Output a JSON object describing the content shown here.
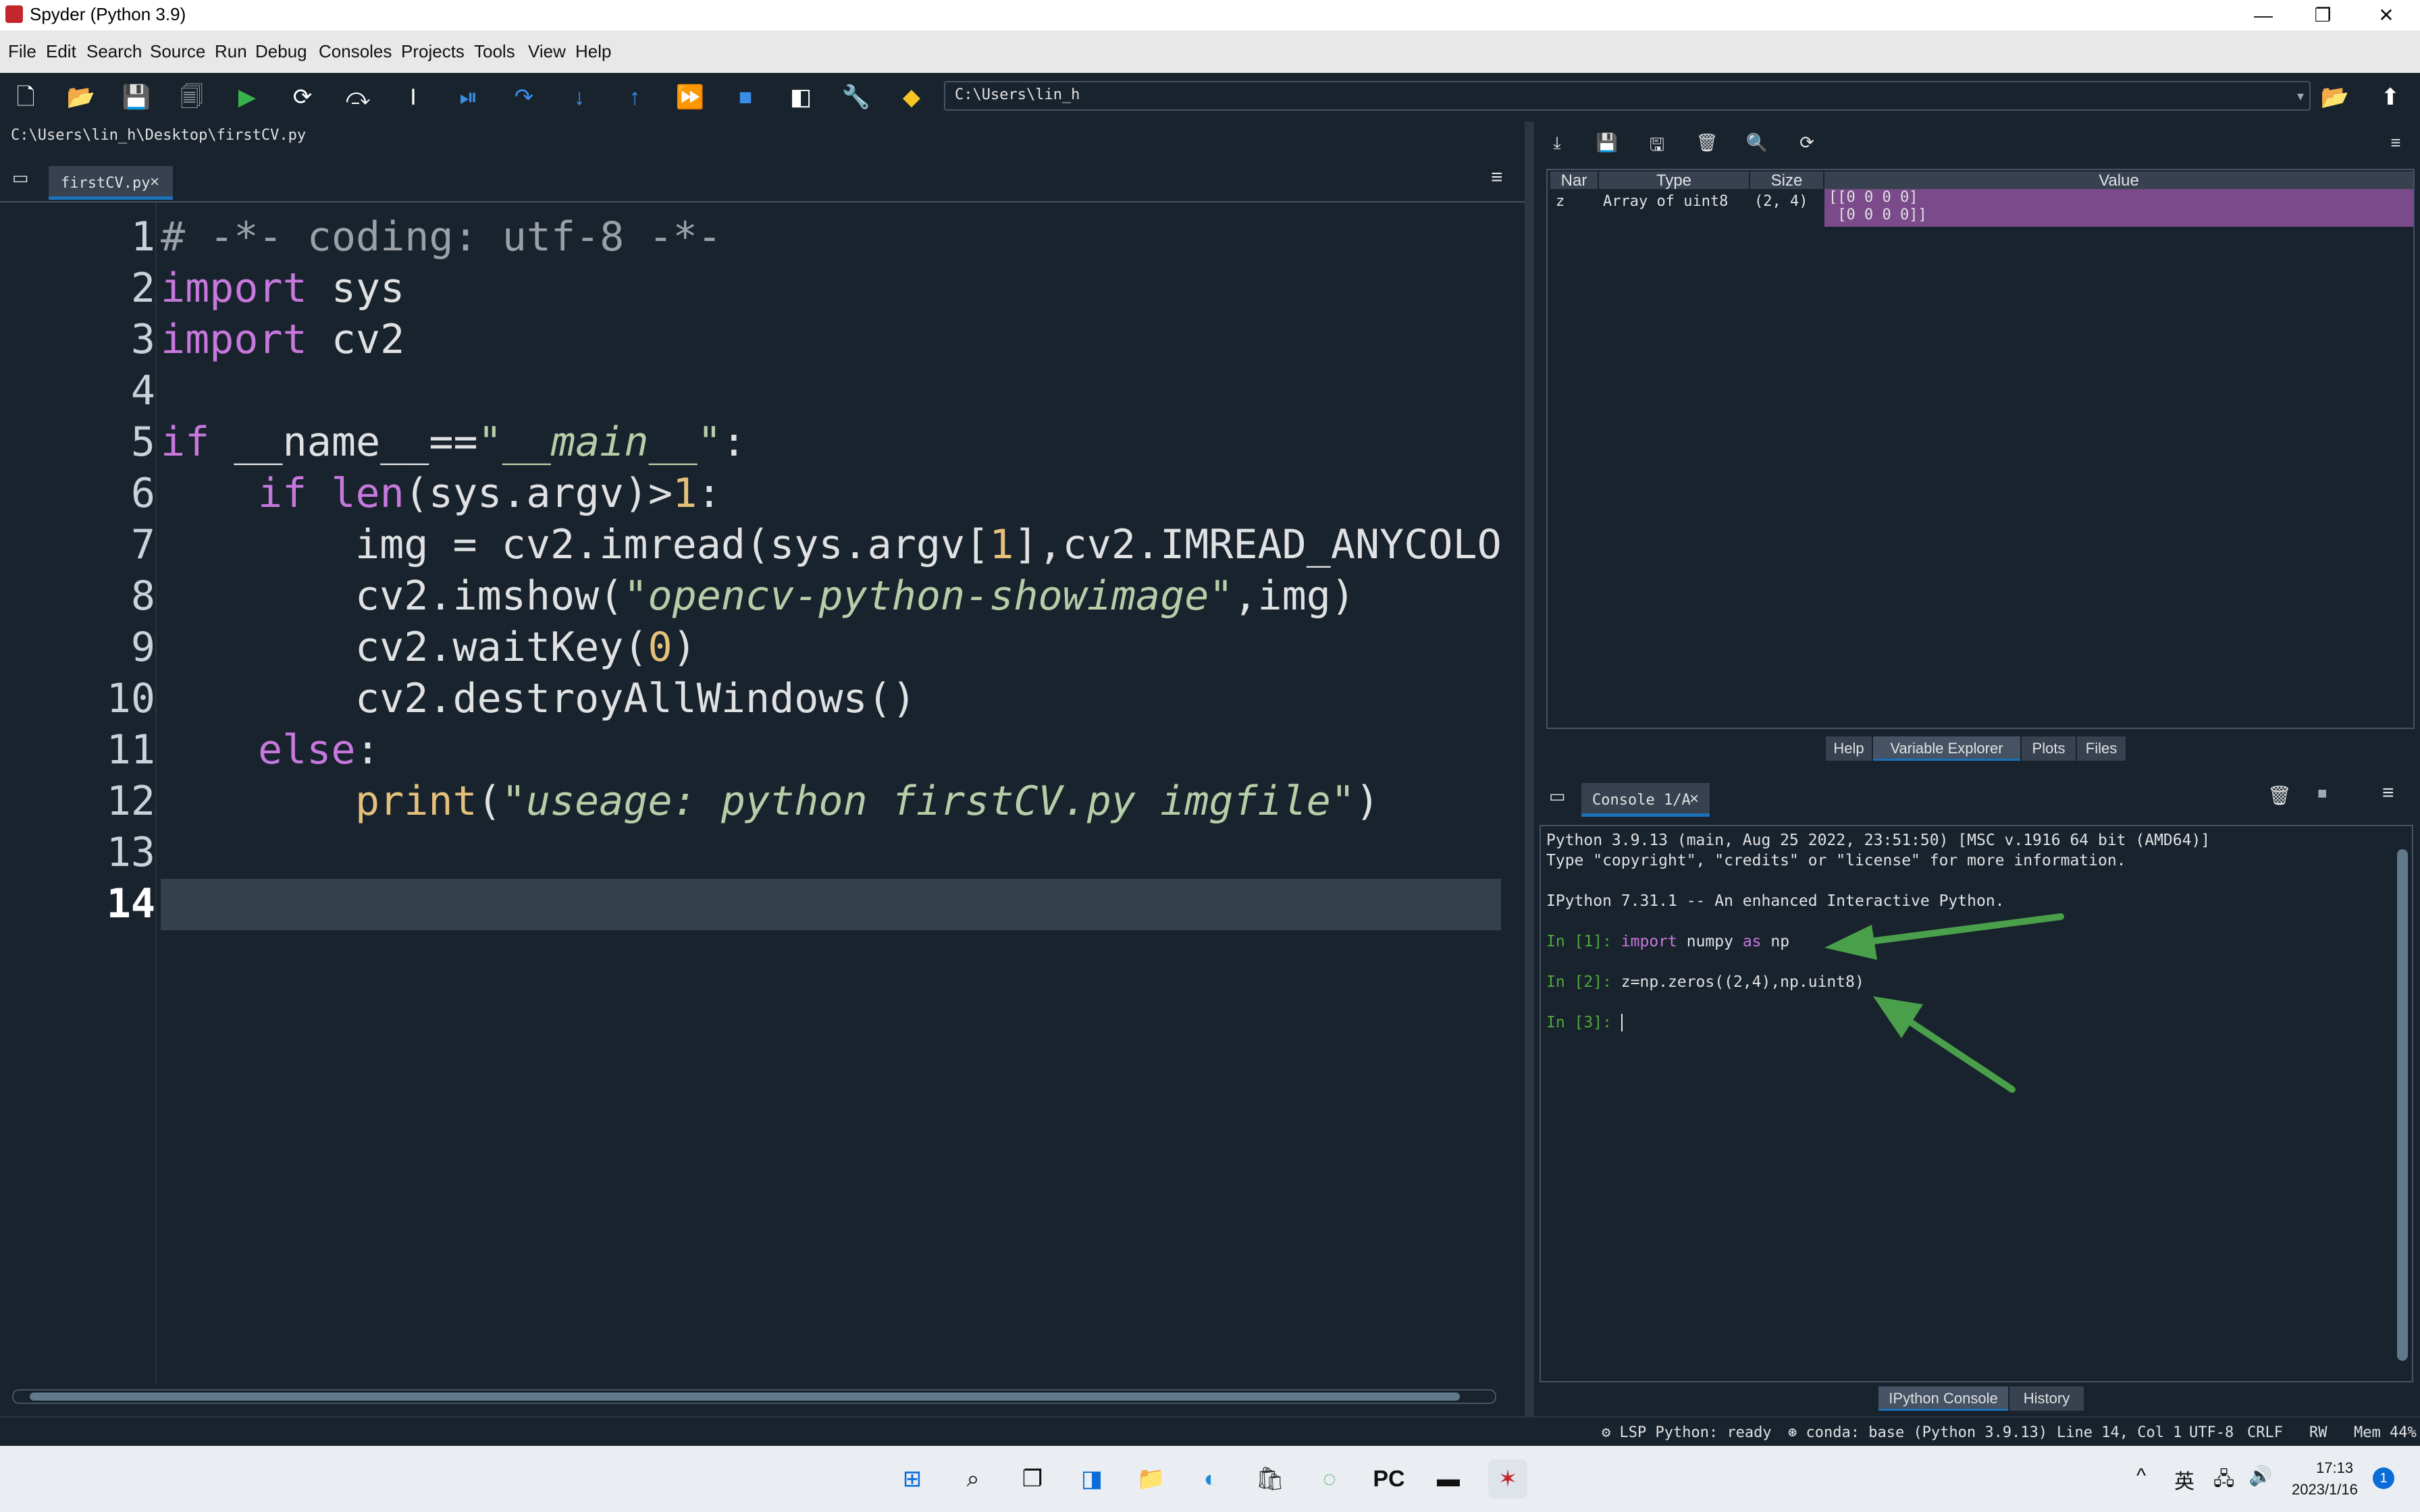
{
  "window": {
    "title": "Spyder (Python 3.9)",
    "controls": {
      "minimize": "—",
      "restore": "❐",
      "close": "✕"
    }
  },
  "menubar": {
    "items": [
      "File",
      "Edit",
      "Search",
      "Source",
      "Run",
      "Debug",
      "Consoles",
      "Projects",
      "Tools",
      "View",
      "Help"
    ]
  },
  "toolbar": {
    "icons": [
      "new-file-icon",
      "open-file-icon",
      "save-icon",
      "save-all-icon",
      "run-icon",
      "run-cell-icon",
      "run-cell-advance-icon",
      "run-selection-icon",
      "debug-icon",
      "step-icon",
      "step-into-icon",
      "step-return-icon",
      "continue-icon",
      "stop-icon",
      "maximize-pane-icon",
      "preferences-wrench-icon",
      "python-path-icon"
    ],
    "working_dir": "C:\\Users\\lin_h",
    "browse_icon": "folder-icon",
    "parent_icon": "up-arrow-icon"
  },
  "editor": {
    "file_path": "C:\\Users\\lin_h\\Desktop\\firstCV.py",
    "tab_label": "firstCV.py",
    "current_line": 14,
    "line_numbers": [
      "1",
      "2",
      "3",
      "4",
      "5",
      "6",
      "7",
      "8",
      "9",
      "10",
      "11",
      "12",
      "13",
      "14"
    ],
    "code": {
      "l1": "# -*- coding: utf-8 -*-",
      "l2_kw": "import",
      "l2_rest": " sys",
      "l3_kw": "import",
      "l3_rest": " cv2",
      "l5_kw": "if",
      "l5_mid": " __name__==",
      "l5_str": "\"__main__\"",
      "l5_end": ":",
      "l6_kw": "if",
      "l6_fn": " len",
      "l6_mid": "(sys.argv)>",
      "l6_num": "1",
      "l6_end": ":",
      "l7_a": "img = cv2.imread(sys.argv[",
      "l7_num": "1",
      "l7_b": "],cv2.IMREAD_ANYCOLO",
      "l8_a": "cv2.imshow(",
      "l8_str": "\"opencv-python-showimage\"",
      "l8_b": ",img)",
      "l9_a": "cv2.waitKey(",
      "l9_num": "0",
      "l9_b": ")",
      "l10": "cv2.destroyAllWindows()",
      "l11_kw": "else",
      "l11_end": ":",
      "l12_fn": "print",
      "l12_a": "(",
      "l12_str": "\"useage: python firstCV.py imgfile\"",
      "l12_b": ")"
    }
  },
  "variable_explorer": {
    "columns": [
      "Nar",
      "Type",
      "Size",
      "Value"
    ],
    "rows": [
      {
        "name": "z",
        "type": "Array of uint8",
        "size": "(2, 4)",
        "value_1": "[[0 0 0 0]",
        "value_2": " [0 0 0 0]]"
      }
    ],
    "tabs": [
      "Help",
      "Variable Explorer",
      "Plots",
      "Files"
    ],
    "active_tab": "Variable Explorer"
  },
  "console": {
    "tab_label": "Console 1/A",
    "lines": {
      "banner1": "Python 3.9.13 (main, Aug 25 2022, 23:51:50) [MSC v.1916 64 bit (AMD64)]",
      "banner2": "Type \"copyright\", \"credits\" or \"license\" for more information.",
      "banner3": "IPython 7.31.1 -- An enhanced Interactive Python.",
      "in1_prompt": "In [1]: ",
      "in1_kw1": "import",
      "in1_mid": " numpy ",
      "in1_kw2": "as",
      "in1_end": " np",
      "in2_prompt": "In [2]: ",
      "in2_code": "z=np.zeros((2,4),np.uint8)",
      "in3_prompt": "In [3]: "
    },
    "tabs": [
      "IPython Console",
      "History"
    ],
    "active_tab": "IPython Console"
  },
  "annotations": {
    "arrow_color": "#4aa04a"
  },
  "statusbar": {
    "lsp": "LSP Python: ready",
    "conda": "conda: base (Python 3.9.13)",
    "position": "Line 14, Col 1",
    "encoding": "UTF-8",
    "eol": "CRLF",
    "rw": "RW",
    "mem": "Mem 44%"
  },
  "taskbar": {
    "apps": [
      "windows-start-icon",
      "search-icon",
      "task-view-icon",
      "widgets-icon",
      "file-explorer-icon",
      "edge-icon",
      "store-icon",
      "anaconda-icon",
      "pycharm-icon",
      "terminal-icon",
      "spyder-icon"
    ],
    "ime": "英",
    "time": "17:13",
    "date": "2023/1/16",
    "notification_count": "1"
  },
  "colors": {
    "bg": "#19232d",
    "accent": "#1a72bb",
    "keyword": "#c678dd",
    "string": "#b5cea8",
    "number": "#e5c07b",
    "highlight_row": "#7a4a8a"
  }
}
